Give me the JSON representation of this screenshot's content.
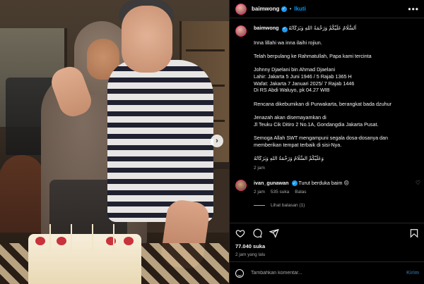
{
  "post": {
    "username": "baimwong",
    "follow_label": "Ikuti",
    "more_label": "•••",
    "separator": "•"
  },
  "caption": {
    "username": "baimwong",
    "lines": [
      "اَلسَّلَامُ عَلَيْكُمْ وَرَحْمَةُ اللهِ وَبَرَكَاتُهُ",
      "",
      "Inna lillahi wa inna ilaihi rojiun.",
      "",
      "Telah berpulang ke Rahmatullah, Papa kami tercinta",
      "",
      "Johnny Djaelani bin Ahmad Djaelani",
      "Lahir: Jakarta 5 Juni 1946 / 5 Rajab 1365 H",
      "Wafat: Jakarta 7 Januari 2025/ 7 Rajab 1446",
      "Di RS Abdi Waluyo, pk 04.27 WIB",
      "",
      "Rencana dikebumikan di Purwakarta, berangkat bada dzuhur",
      "",
      "Jenazah akan disemayamkan di",
      "Jl Teuku Cik Ditiro 2 No.1A, Gondangdia Jakarta Pusat.",
      "",
      "Semoga Allah SWT mengampuni segala dosa-dosanya dan",
      "memberikan tempat terbaik di sisi-Nya.",
      "",
      "وَعَلَيْكُمْ السَّلَامُ وَرَحْمَةُ اللهِ وَبَرَكَاتُهُ"
    ],
    "time": "2 jam"
  },
  "comment": {
    "username": "ivan_gunawan",
    "text": "Turut berduka baim 😔",
    "time": "2 jam",
    "likes": "535 suka",
    "reply_label": "Balas",
    "view_replies": "Lihat balasan (1)"
  },
  "engagement": {
    "likes": "77.040 suka",
    "posted_ago": "2 jam yang lalu"
  },
  "composer": {
    "placeholder": "Tambahkan komentar...",
    "post_label": "Kirim"
  },
  "colors": {
    "accent": "#0095f6",
    "verified": "#1d9bf0",
    "muted": "#a8a8a8",
    "background": "#000000"
  },
  "icons": [
    "heart-icon",
    "comment-icon",
    "share-icon",
    "bookmark-icon",
    "emoji-icon",
    "verified-icon",
    "chevron-right-icon"
  ]
}
